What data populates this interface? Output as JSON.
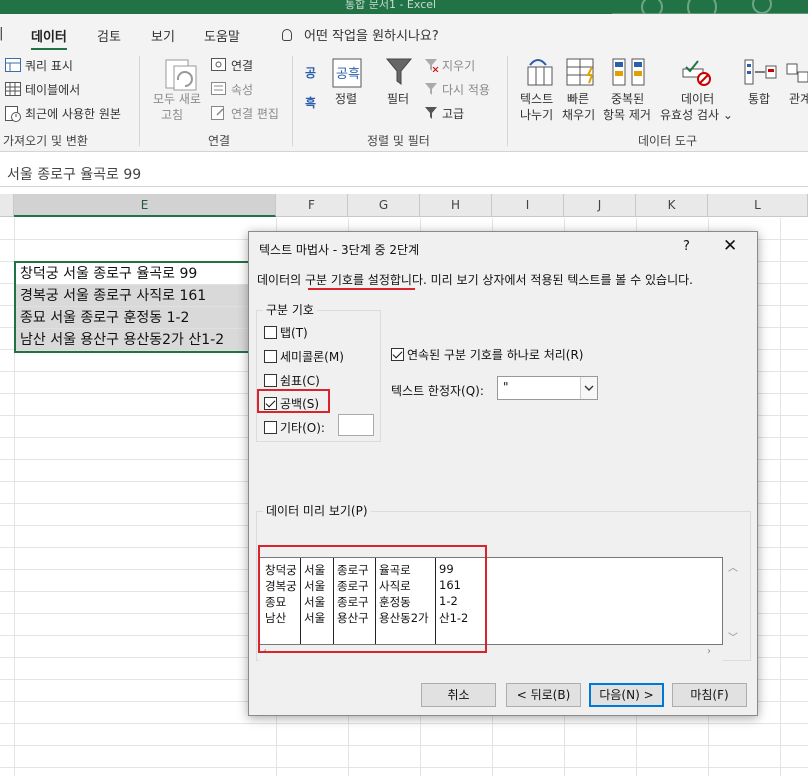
{
  "window": {
    "title": "통합 문서1  -  Excel"
  },
  "tabs": [
    {
      "label": "데이터",
      "active": true
    },
    {
      "label": "검토",
      "active": false
    },
    {
      "label": "보기",
      "active": false
    },
    {
      "label": "도움말",
      "active": false
    }
  ],
  "tell_me": "어떤 작업을 원하시나요?",
  "ribbon": {
    "get_data": {
      "items": [
        "쿼리 표시",
        "테이블에서",
        "최근에 사용한 원본"
      ],
      "group_label": "가져오기 및 변환"
    },
    "connections": {
      "refresh_line1": "모두 새로",
      "refresh_line2": "고침",
      "items": [
        "연결",
        "속성",
        "연결 편집"
      ],
      "group_label": "연결"
    },
    "sort_filter": {
      "sort": "정렬",
      "filter": "필터",
      "items": [
        "지우기",
        "다시 적용",
        "고급"
      ],
      "group_label": "정렬 및 필터",
      "sort_az_glyph": "공",
      "sort_za_glyph": "흑"
    },
    "data_tools": {
      "buttons": [
        {
          "line1": "텍스트",
          "line2": "나누기"
        },
        {
          "line1": "빠른",
          "line2": "채우기"
        },
        {
          "line1": "중복된",
          "line2": "항목 제거"
        },
        {
          "line1": "데이터",
          "line2": "유효성 검사 ⌄"
        }
      ],
      "group_label": "데이터 도구"
    },
    "consolidate": "통합",
    "relations": "관계"
  },
  "formula_bar": {
    "value": "서울 종로구 율곡로 99"
  },
  "columns": [
    "E",
    "F",
    "G",
    "H",
    "I",
    "J",
    "K",
    "L"
  ],
  "cells": [
    "창덕궁 서울 종로구 율곡로 99",
    "경복궁 서울 종로구 사직로 161",
    "종묘 서울 종로구 훈정동 1-2",
    "남산 서울 용산구 용산동2가 산1-2"
  ],
  "dialog": {
    "title": "텍스트 마법사 - 3단계 중 2단계",
    "help": "?",
    "close": "✕",
    "description": "데이터의 구분 기호를 설정합니다. 미리 보기 상자에서 적용된 텍스트를 볼 수 있습니다.",
    "delimiters_label": "구분 기호",
    "delimiters": [
      {
        "label": "탭(T)",
        "checked": false
      },
      {
        "label": "세미콜론(M)",
        "checked": false
      },
      {
        "label": "쉼표(C)",
        "checked": false
      },
      {
        "label": "공백(S)",
        "checked": true
      },
      {
        "label": "기타(O):",
        "checked": false
      }
    ],
    "treat_consecutive": {
      "label": "연속된 구분 기호를 하나로 처리(R)",
      "checked": true
    },
    "text_qualifier": {
      "label": "텍스트 한정자(Q):",
      "value": "\""
    },
    "preview_label": "데이터 미리 보기(P)",
    "preview_rows": [
      [
        "창덕궁",
        "서울",
        "종로구",
        "율곡로",
        "99"
      ],
      [
        "경복궁",
        "서울",
        "종로구",
        "사직로",
        "161"
      ],
      [
        "종묘",
        "서울",
        "종로구",
        "훈정동",
        "1-2"
      ],
      [
        "남산",
        "서울",
        "용산구",
        "용산동2가",
        "산1-2"
      ]
    ],
    "buttons": {
      "cancel": "취소",
      "back": "< 뒤로(B)",
      "next": "다음(N) >",
      "finish": "마침(F)"
    }
  },
  "colors": {
    "excel_green": "#217346",
    "annotation_red": "#d9232d",
    "focus_blue": "#0078d7"
  }
}
